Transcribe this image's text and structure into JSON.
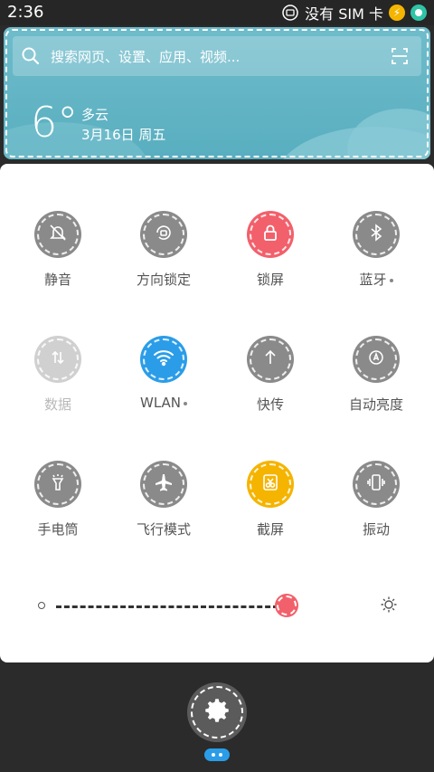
{
  "status_bar": {
    "time": "2:36",
    "sim_text": "没有 SIM 卡"
  },
  "header": {
    "search_placeholder": "搜索网页、设置、应用、视频...",
    "temperature": "6°",
    "condition": "多云",
    "date": "3月16日 周五"
  },
  "toggles": [
    {
      "label": "静音",
      "icon": "bell-mute-icon",
      "color": "#8a8a8a",
      "dot": false
    },
    {
      "label": "方向锁定",
      "icon": "rotation-lock-icon",
      "color": "#8a8a8a",
      "dot": false
    },
    {
      "label": "锁屏",
      "icon": "lock-icon",
      "color": "#f2606b",
      "dot": false
    },
    {
      "label": "蓝牙",
      "icon": "bluetooth-icon",
      "color": "#8a8a8a",
      "dot": true
    },
    {
      "label": "数据",
      "icon": "mobile-data-icon",
      "color": "#d0d0d0",
      "dot": false,
      "disabled": true
    },
    {
      "label": "WLAN",
      "icon": "wifi-icon",
      "color": "#2b9de8",
      "dot": true
    },
    {
      "label": "快传",
      "icon": "upload-arrow-icon",
      "color": "#8a8a8a",
      "dot": false
    },
    {
      "label": "自动亮度",
      "icon": "auto-brightness-icon",
      "color": "#8a8a8a",
      "dot": false
    },
    {
      "label": "手电筒",
      "icon": "flashlight-icon",
      "color": "#8a8a8a",
      "dot": false
    },
    {
      "label": "飞行模式",
      "icon": "airplane-icon",
      "color": "#8a8a8a",
      "dot": false
    },
    {
      "label": "截屏",
      "icon": "screenshot-icon",
      "color": "#f5b400",
      "dot": false
    },
    {
      "label": "振动",
      "icon": "vibrate-icon",
      "color": "#8a8a8a",
      "dot": false
    }
  ],
  "brightness": {
    "level": 0.92
  }
}
